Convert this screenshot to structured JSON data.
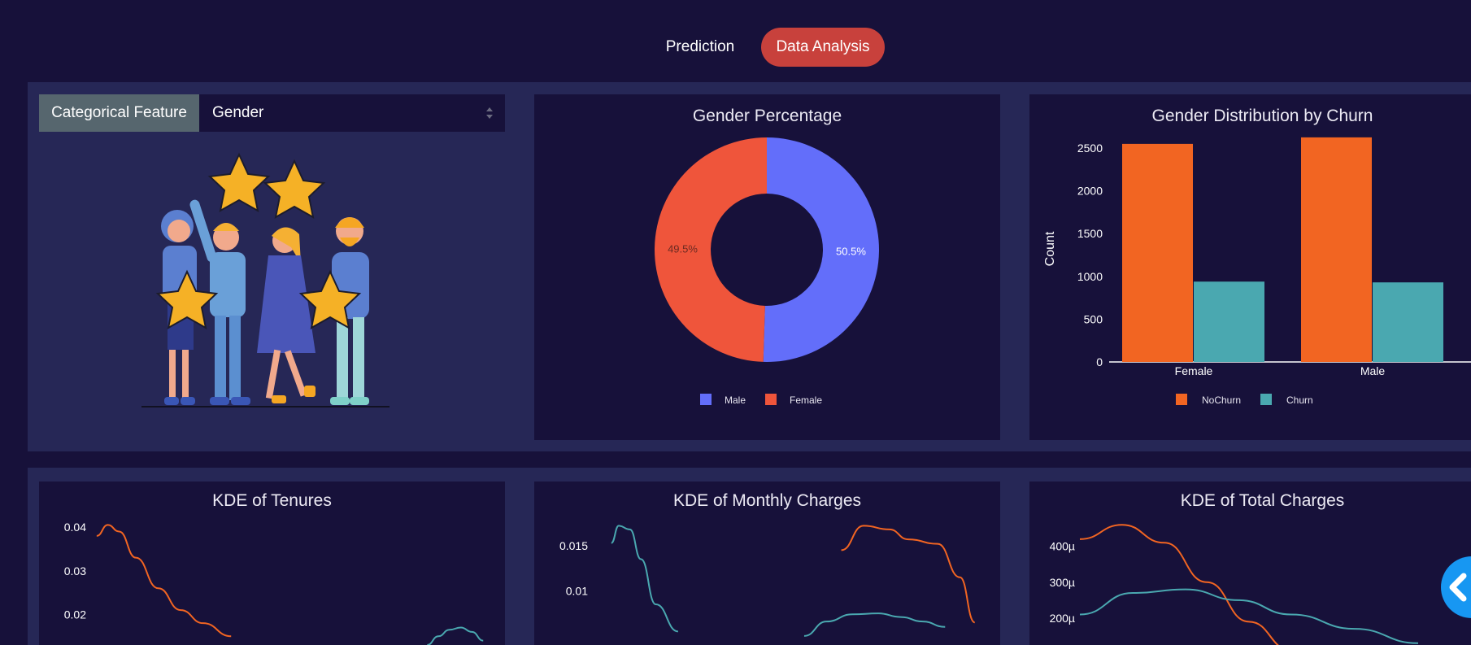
{
  "nav": {
    "tabs": [
      {
        "label": "Prediction",
        "active": false
      },
      {
        "label": "Data Analysis",
        "active": true
      }
    ],
    "active_color": "#c8413c"
  },
  "feature_selector": {
    "label": "Categorical Feature",
    "selected": "Gender"
  },
  "colors": {
    "background": "#17113a",
    "panel": "#262756",
    "male": "#636efa",
    "female": "#ef553b",
    "nochurn": "#f26522",
    "churn": "#4aa8b0"
  },
  "chart_data": [
    {
      "type": "pie",
      "title": "Gender Percentage",
      "hole": true,
      "labels": [
        "Male",
        "Female"
      ],
      "values": [
        50.5,
        49.5
      ],
      "text": [
        "50.5%",
        "49.5%"
      ],
      "legend": "bottom-center"
    },
    {
      "type": "bar",
      "title": "Gender Distribution by Churn",
      "categories": [
        "Female",
        "Male"
      ],
      "series": [
        {
          "name": "NoChurn",
          "values": [
            2549,
            2625
          ]
        },
        {
          "name": "Churn",
          "values": [
            939,
            930
          ]
        }
      ],
      "xlabel": "",
      "ylabel": "Count",
      "yticks": [
        "0",
        "500",
        "1000",
        "1500",
        "2000",
        "2500"
      ],
      "ylim": [
        0,
        2700
      ],
      "legend": "bottom-center"
    },
    {
      "type": "line",
      "title": "KDE of Tenures",
      "yticks": [
        "0.04",
        "0.03",
        "0.02"
      ],
      "series": [
        {
          "name": "",
          "x": [
            1,
            3,
            5,
            8,
            12,
            16,
            20,
            25
          ],
          "y": [
            0.038,
            0.0405,
            0.039,
            0.033,
            0.026,
            0.021,
            0.018,
            0.015
          ]
        },
        {
          "name": "",
          "x": [
            60,
            62,
            64,
            66,
            68,
            70
          ],
          "y": [
            0.013,
            0.015,
            0.0165,
            0.017,
            0.016,
            0.014
          ]
        }
      ]
    },
    {
      "type": "line",
      "title": "KDE of Monthly Charges",
      "yticks": [
        "0.015",
        "0.01"
      ],
      "series": [
        {
          "name": "",
          "x": [
            20,
            22,
            25,
            28,
            32,
            38
          ],
          "y": [
            0.0153,
            0.0172,
            0.0168,
            0.0135,
            0.0085,
            0.0055
          ]
        },
        {
          "name": "",
          "x": [
            72,
            78,
            85,
            92,
            98,
            104,
            110
          ],
          "y": [
            0.005,
            0.0066,
            0.0074,
            0.0075,
            0.0071,
            0.0066,
            0.006
          ]
        },
        {
          "name": "",
          "x": [
            82,
            88,
            95,
            100,
            108,
            114,
            118
          ],
          "y": [
            0.0145,
            0.0172,
            0.0168,
            0.0157,
            0.0152,
            0.0115,
            0.0065
          ]
        }
      ]
    },
    {
      "type": "line",
      "title": "KDE of Total Charges",
      "yticks": [
        "400µ",
        "300µ",
        "200µ"
      ],
      "series": [
        {
          "name": "",
          "x": [
            0,
            200,
            400,
            600,
            800,
            1000,
            1200
          ],
          "y": [
            0.00042,
            0.00046,
            0.00041,
            0.0003,
            0.00019,
            0.00011,
            5e-05
          ]
        },
        {
          "name": "",
          "x": [
            0,
            250,
            500,
            750,
            1000,
            1300,
            1600
          ],
          "y": [
            0.00021,
            0.00027,
            0.00028,
            0.00025,
            0.00021,
            0.00017,
            0.00013
          ]
        }
      ]
    }
  ]
}
